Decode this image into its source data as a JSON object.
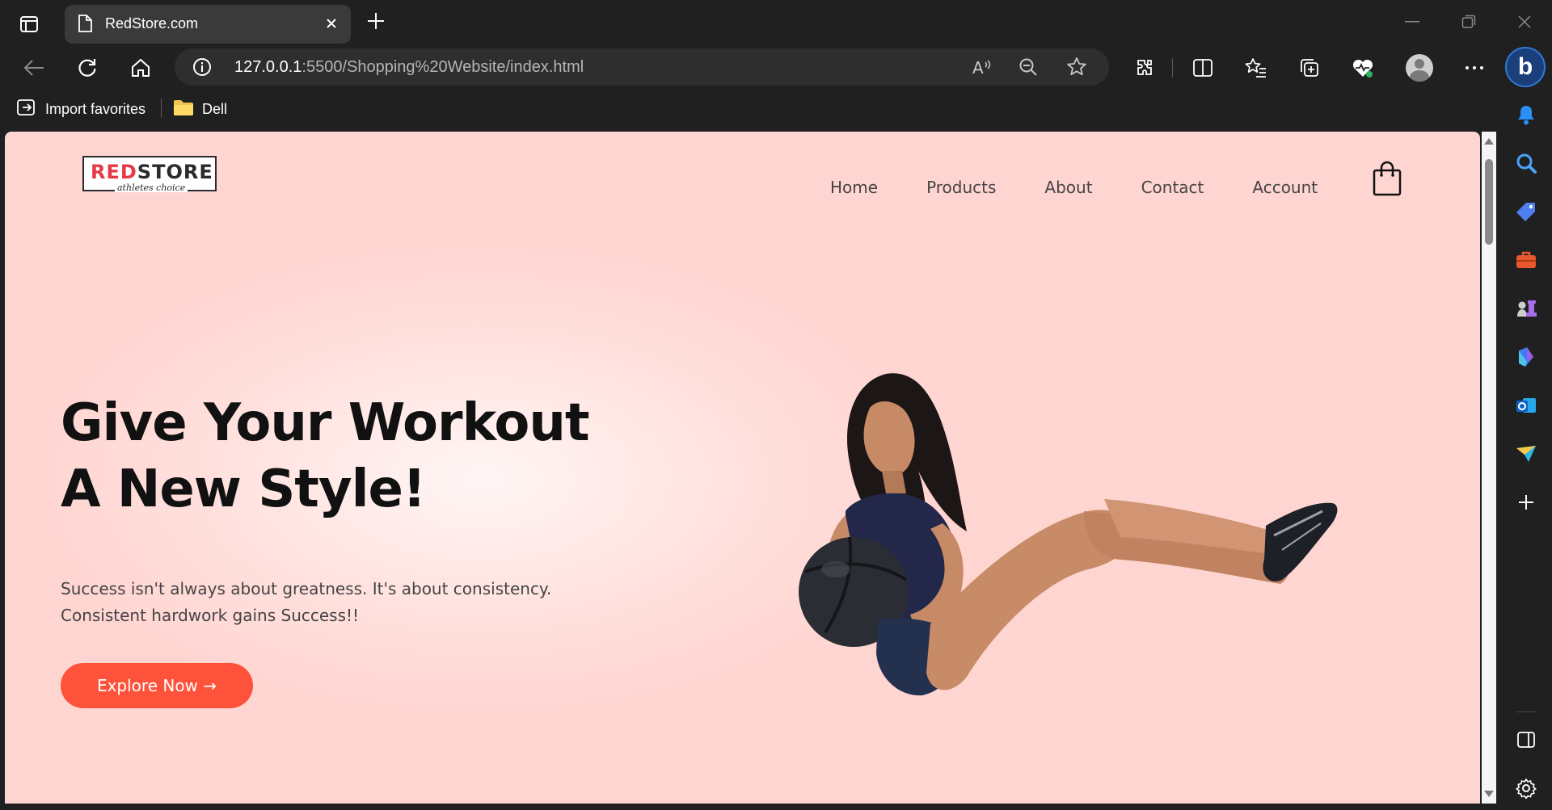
{
  "browser": {
    "tab": {
      "title": "RedStore.com",
      "icon": "page-icon"
    },
    "address": {
      "host": "127.0.0.1",
      "rest": ":5500/Shopping%20Website/index.html"
    },
    "favorites": [
      {
        "label": "Import favorites",
        "icon": "import-favorites-icon"
      },
      {
        "label": "Dell",
        "icon": "folder-icon"
      }
    ],
    "bing_label": "b"
  },
  "site": {
    "logo": {
      "part1": "RED",
      "part2": "STORE",
      "tagline": "athletes choice"
    },
    "nav": [
      "Home",
      "Products",
      "About",
      "Contact",
      "Account"
    ],
    "hero": {
      "title_line1": "Give Your Workout",
      "title_line2": "A New Style!",
      "text_line1": "Success isn't always about greatness. It's about consistency.",
      "text_line2": "Consistent hardwork gains Success!!",
      "cta": "Explore Now →"
    }
  },
  "colors": {
    "accent": "#ff523b",
    "page_bg": "#ffd5d1",
    "browser_bg": "#202020"
  }
}
